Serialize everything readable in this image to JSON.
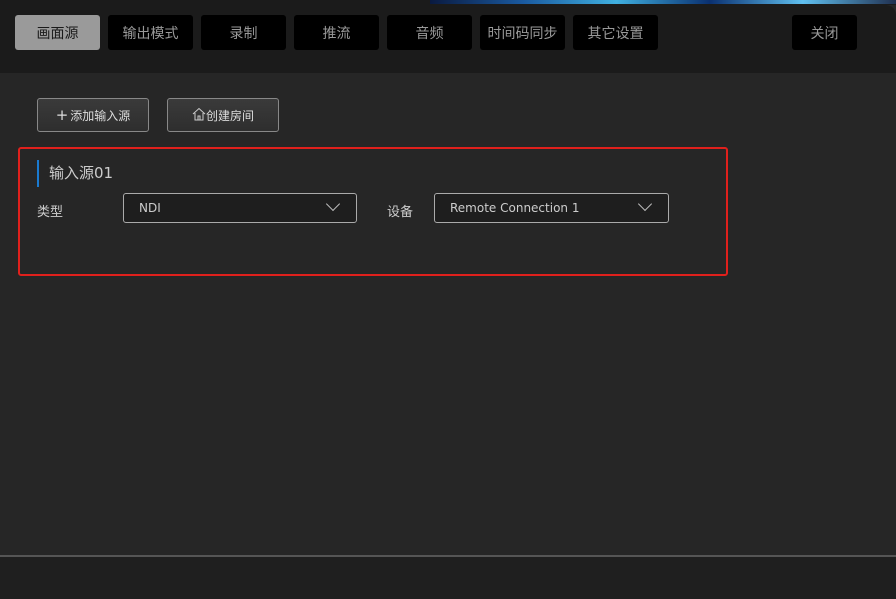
{
  "tabs": [
    {
      "label": "画面源",
      "active": true
    },
    {
      "label": "输出模式"
    },
    {
      "label": "录制"
    },
    {
      "label": "推流"
    },
    {
      "label": "音频"
    },
    {
      "label": "时间码同步"
    },
    {
      "label": "其它设置"
    }
  ],
  "close_label": "关闭",
  "toolbar": {
    "add_source": "添加输入源",
    "create_room": "创建房间"
  },
  "source": {
    "title": "输入源01",
    "type_label": "类型",
    "type_value": "NDI",
    "device_label": "设备",
    "device_value": "Remote Connection 1"
  },
  "colors": {
    "highlight": "#e0201c",
    "accent": "#1a7ad0"
  }
}
